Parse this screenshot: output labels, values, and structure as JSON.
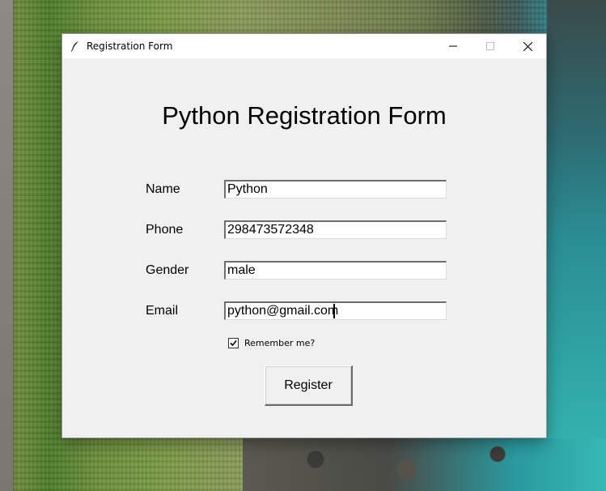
{
  "window": {
    "title": "Registration Form",
    "icon": "feather-icon",
    "controls": [
      "minimize-icon",
      "maximize-icon",
      "close-icon"
    ]
  },
  "form": {
    "heading": "Python Registration Form",
    "fields": [
      {
        "label": "Name",
        "value": "Python"
      },
      {
        "label": "Phone",
        "value": "298473572348"
      },
      {
        "label": "Gender",
        "value": "male"
      },
      {
        "label": "Email",
        "value": "python@gmail.com"
      }
    ],
    "remember": {
      "label": "Remember me?",
      "checked": true
    },
    "register_label": "Register"
  }
}
